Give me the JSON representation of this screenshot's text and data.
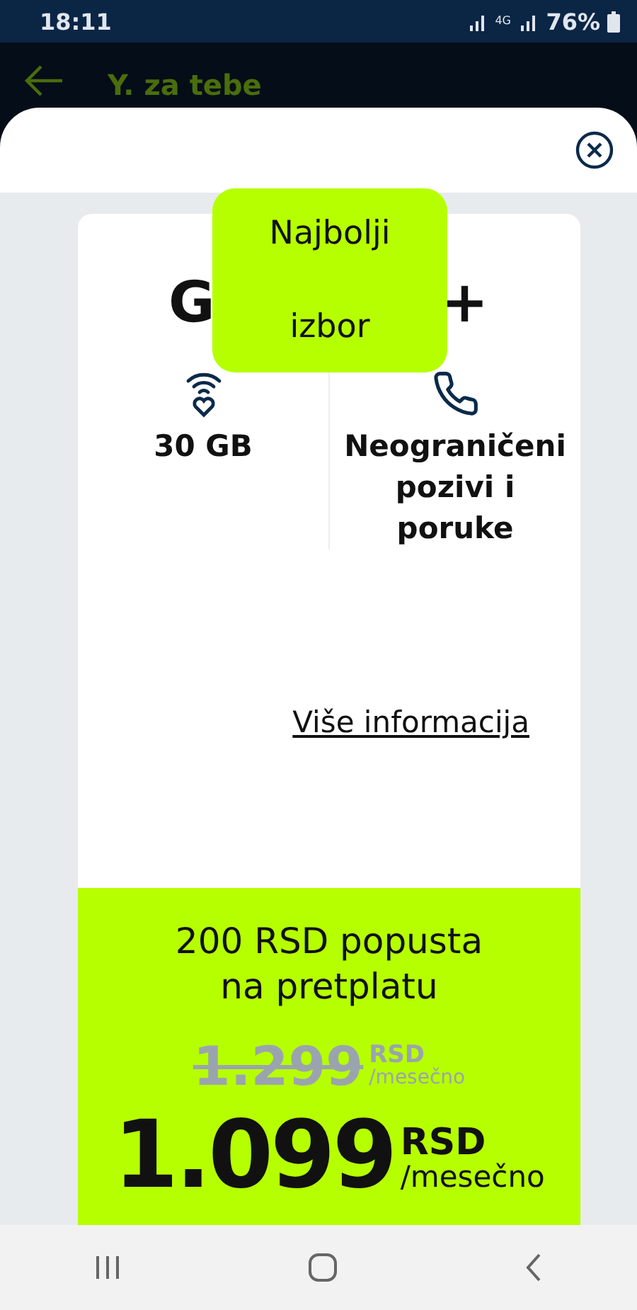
{
  "status_bar": {
    "time": "18:11",
    "network": "4G",
    "battery": "76%"
  },
  "app_bar": {
    "title": "Y. za tebe"
  },
  "card": {
    "badge": "Najbolji izbor",
    "title_start": "G",
    "title_end": "+",
    "features": [
      {
        "kind": "data",
        "label": "30 GB"
      },
      {
        "kind": "calls",
        "label": "Neograničeni pozivi i poruke"
      }
    ],
    "more_link": "Više informacija",
    "offer": {
      "discount": "200 RSD popusta na pretplatu",
      "old_price": "1.299",
      "old_currency": "RSD",
      "old_period": "/mesečno",
      "price": "1.099",
      "currency": "RSD",
      "period": "/mesečno"
    }
  }
}
